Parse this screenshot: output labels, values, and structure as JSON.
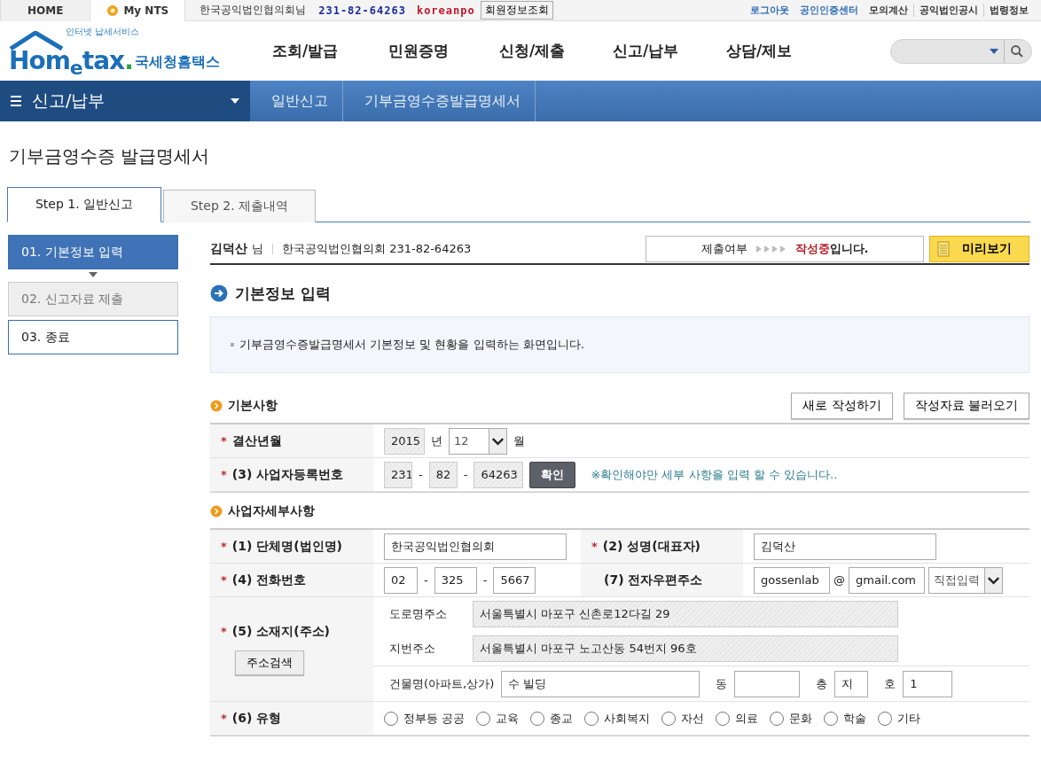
{
  "topbar": {
    "links": [
      {
        "label": "HOME",
        "kind": "plain"
      },
      {
        "label": "My NTS",
        "kind": "star"
      }
    ],
    "user": "한국공익법인협의회님",
    "bizno": "231-82-64263",
    "user_id": "koreanpo",
    "member_button": "회원정보조회",
    "right_links": [
      {
        "label": "로그아웃",
        "kind": "accent"
      },
      {
        "label": "공인인증센터",
        "kind": "accent"
      },
      {
        "label": "모의계산",
        "kind": "plain"
      },
      {
        "label": "공익법인공시",
        "kind": "plain"
      },
      {
        "label": "법령정보",
        "kind": "plain"
      }
    ]
  },
  "header": {
    "logo": {
      "tagline": "인터넷 납세서비스",
      "brand_a": "Hom",
      "brand_e": "e",
      "brand_b": "tax",
      "brand_dot": ".",
      "korean": "국세청홈택스"
    },
    "menu": [
      "조회/발급",
      "민원증명",
      "신청/제출",
      "신고/납부",
      "상담/제보"
    ]
  },
  "breadcrumb": {
    "menu": "신고/납부",
    "items": [
      "일반신고",
      "기부금영수증발급명세서"
    ]
  },
  "page_title": "기부금영수증 발급명세서",
  "tabs": [
    {
      "label": "Step 1. 일반신고",
      "selected": true
    },
    {
      "label": "Step 2. 제출내역",
      "selected": false
    }
  ],
  "steps": [
    {
      "label": "01. 기본정보 입력",
      "selected": true,
      "disabled": false
    },
    {
      "label": "02. 신고자료 제출",
      "selected": false,
      "disabled": true
    },
    {
      "label": "03. 종료",
      "selected": false,
      "disabled": false
    }
  ],
  "info": {
    "name": "김덕산",
    "suffix": "님",
    "org": "한국공익법인협의회 231-82-64263",
    "status_label": "제출여부",
    "status_value": "작성중",
    "status_suffix": "입니다.",
    "preview_button": "미리보기"
  },
  "section_title": "기본정보 입력",
  "notice": "기부금영수증발급명세서 기본정보 및 현황을 입력하는 화면입니다.",
  "basic": {
    "title": "기본사항",
    "buttons": [
      "새로 작성하기",
      "작성자료 불러오기"
    ],
    "period": {
      "label": "결산년월",
      "mark": "*",
      "year": "2015",
      "year_unit": "년",
      "month": "12",
      "month_unit": "월"
    },
    "bizno": {
      "label": "(3) 사업자등록번호",
      "mark": "*",
      "parts": [
        "231",
        "82",
        "64263"
      ],
      "separator": "-",
      "confirm_button": "확인",
      "hint": "※확인해야만 세부 사항을 입력 할 수 있습니다.."
    }
  },
  "detail": {
    "title": "사업자세부사항",
    "org_name": {
      "label": "(1) 단체명(법인명)",
      "mark": "*",
      "value": "한국공익법인협의회"
    },
    "rep": {
      "label": "(2) 성명(대표자)",
      "mark": "*",
      "value": "김덕산"
    },
    "phone": {
      "label": "(4) 전화번호",
      "mark": "*",
      "parts": [
        "02",
        "325",
        "5667"
      ],
      "separator": "-"
    },
    "email": {
      "label": "(7) 전자우편주소",
      "user": "gossenlab",
      "at": "@",
      "domain": "gmail.com",
      "select": "직접입력"
    },
    "address": {
      "label": "(5) 소재지(주소)",
      "mark": "*",
      "search_button": "주소검색",
      "road_label": "도로명주소",
      "road": "서울특별시 마포구 신촌로12다길 29",
      "lot_label": "지번주소",
      "lot": "서울특별시 마포구 노고산동 54번지 96호",
      "building_label": "건물명(아파트,상가)",
      "building": "수 빌딩",
      "dong_label": "동",
      "floor_label": "층",
      "floor": "지",
      "ho_label": "호",
      "ho": "1"
    },
    "type": {
      "label": "(6) 유형",
      "mark": "*",
      "options": [
        {
          "label": "정부등 공공",
          "selected": false
        },
        {
          "label": "교육",
          "selected": false
        },
        {
          "label": "종교",
          "selected": false
        },
        {
          "label": "사회복지",
          "selected": false
        },
        {
          "label": "자선",
          "selected": false
        },
        {
          "label": "의료",
          "selected": false
        },
        {
          "label": "문화",
          "selected": false
        },
        {
          "label": "학술",
          "selected": false
        },
        {
          "label": "기타",
          "selected": false
        }
      ]
    }
  }
}
